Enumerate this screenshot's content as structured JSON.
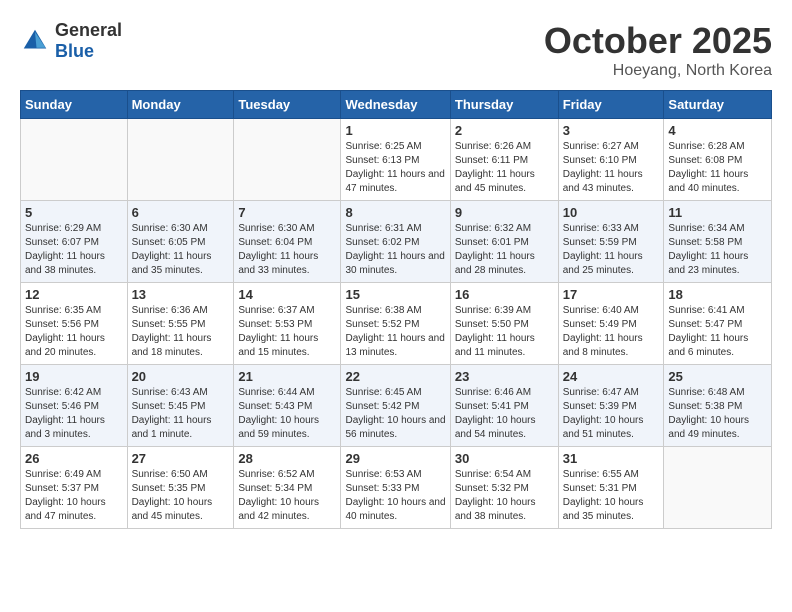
{
  "header": {
    "logo_general": "General",
    "logo_blue": "Blue",
    "month": "October 2025",
    "location": "Hoeyang, North Korea"
  },
  "days_of_week": [
    "Sunday",
    "Monday",
    "Tuesday",
    "Wednesday",
    "Thursday",
    "Friday",
    "Saturday"
  ],
  "weeks": [
    [
      {
        "day": "",
        "info": ""
      },
      {
        "day": "",
        "info": ""
      },
      {
        "day": "",
        "info": ""
      },
      {
        "day": "1",
        "info": "Sunrise: 6:25 AM\nSunset: 6:13 PM\nDaylight: 11 hours and 47 minutes."
      },
      {
        "day": "2",
        "info": "Sunrise: 6:26 AM\nSunset: 6:11 PM\nDaylight: 11 hours and 45 minutes."
      },
      {
        "day": "3",
        "info": "Sunrise: 6:27 AM\nSunset: 6:10 PM\nDaylight: 11 hours and 43 minutes."
      },
      {
        "day": "4",
        "info": "Sunrise: 6:28 AM\nSunset: 6:08 PM\nDaylight: 11 hours and 40 minutes."
      }
    ],
    [
      {
        "day": "5",
        "info": "Sunrise: 6:29 AM\nSunset: 6:07 PM\nDaylight: 11 hours and 38 minutes."
      },
      {
        "day": "6",
        "info": "Sunrise: 6:30 AM\nSunset: 6:05 PM\nDaylight: 11 hours and 35 minutes."
      },
      {
        "day": "7",
        "info": "Sunrise: 6:30 AM\nSunset: 6:04 PM\nDaylight: 11 hours and 33 minutes."
      },
      {
        "day": "8",
        "info": "Sunrise: 6:31 AM\nSunset: 6:02 PM\nDaylight: 11 hours and 30 minutes."
      },
      {
        "day": "9",
        "info": "Sunrise: 6:32 AM\nSunset: 6:01 PM\nDaylight: 11 hours and 28 minutes."
      },
      {
        "day": "10",
        "info": "Sunrise: 6:33 AM\nSunset: 5:59 PM\nDaylight: 11 hours and 25 minutes."
      },
      {
        "day": "11",
        "info": "Sunrise: 6:34 AM\nSunset: 5:58 PM\nDaylight: 11 hours and 23 minutes."
      }
    ],
    [
      {
        "day": "12",
        "info": "Sunrise: 6:35 AM\nSunset: 5:56 PM\nDaylight: 11 hours and 20 minutes."
      },
      {
        "day": "13",
        "info": "Sunrise: 6:36 AM\nSunset: 5:55 PM\nDaylight: 11 hours and 18 minutes."
      },
      {
        "day": "14",
        "info": "Sunrise: 6:37 AM\nSunset: 5:53 PM\nDaylight: 11 hours and 15 minutes."
      },
      {
        "day": "15",
        "info": "Sunrise: 6:38 AM\nSunset: 5:52 PM\nDaylight: 11 hours and 13 minutes."
      },
      {
        "day": "16",
        "info": "Sunrise: 6:39 AM\nSunset: 5:50 PM\nDaylight: 11 hours and 11 minutes."
      },
      {
        "day": "17",
        "info": "Sunrise: 6:40 AM\nSunset: 5:49 PM\nDaylight: 11 hours and 8 minutes."
      },
      {
        "day": "18",
        "info": "Sunrise: 6:41 AM\nSunset: 5:47 PM\nDaylight: 11 hours and 6 minutes."
      }
    ],
    [
      {
        "day": "19",
        "info": "Sunrise: 6:42 AM\nSunset: 5:46 PM\nDaylight: 11 hours and 3 minutes."
      },
      {
        "day": "20",
        "info": "Sunrise: 6:43 AM\nSunset: 5:45 PM\nDaylight: 11 hours and 1 minute."
      },
      {
        "day": "21",
        "info": "Sunrise: 6:44 AM\nSunset: 5:43 PM\nDaylight: 10 hours and 59 minutes."
      },
      {
        "day": "22",
        "info": "Sunrise: 6:45 AM\nSunset: 5:42 PM\nDaylight: 10 hours and 56 minutes."
      },
      {
        "day": "23",
        "info": "Sunrise: 6:46 AM\nSunset: 5:41 PM\nDaylight: 10 hours and 54 minutes."
      },
      {
        "day": "24",
        "info": "Sunrise: 6:47 AM\nSunset: 5:39 PM\nDaylight: 10 hours and 51 minutes."
      },
      {
        "day": "25",
        "info": "Sunrise: 6:48 AM\nSunset: 5:38 PM\nDaylight: 10 hours and 49 minutes."
      }
    ],
    [
      {
        "day": "26",
        "info": "Sunrise: 6:49 AM\nSunset: 5:37 PM\nDaylight: 10 hours and 47 minutes."
      },
      {
        "day": "27",
        "info": "Sunrise: 6:50 AM\nSunset: 5:35 PM\nDaylight: 10 hours and 45 minutes."
      },
      {
        "day": "28",
        "info": "Sunrise: 6:52 AM\nSunset: 5:34 PM\nDaylight: 10 hours and 42 minutes."
      },
      {
        "day": "29",
        "info": "Sunrise: 6:53 AM\nSunset: 5:33 PM\nDaylight: 10 hours and 40 minutes."
      },
      {
        "day": "30",
        "info": "Sunrise: 6:54 AM\nSunset: 5:32 PM\nDaylight: 10 hours and 38 minutes."
      },
      {
        "day": "31",
        "info": "Sunrise: 6:55 AM\nSunset: 5:31 PM\nDaylight: 10 hours and 35 minutes."
      },
      {
        "day": "",
        "info": ""
      }
    ]
  ]
}
